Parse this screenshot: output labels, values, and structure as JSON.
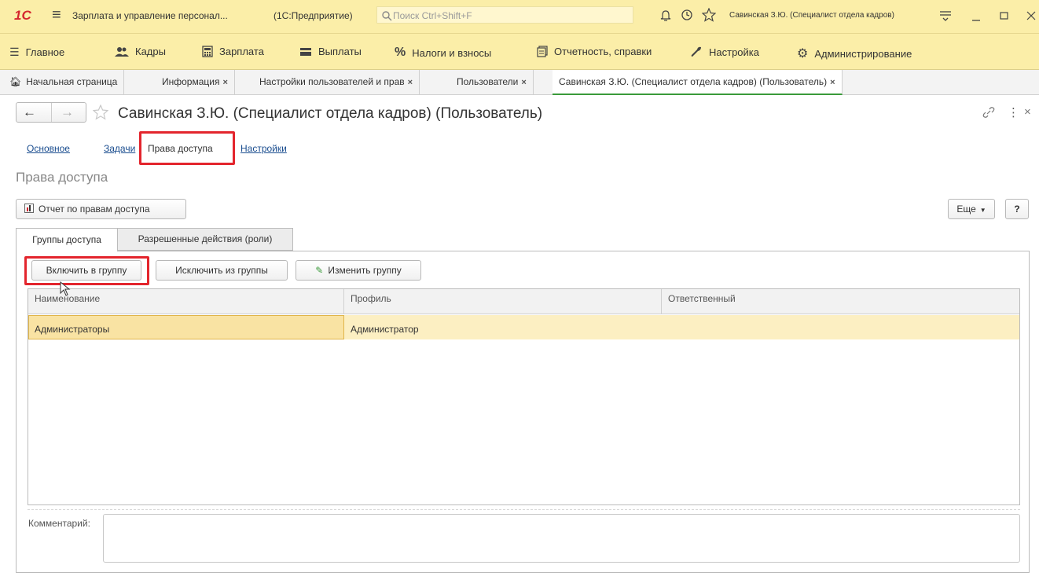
{
  "titlebar": {
    "logo": "1С",
    "menu_glyph": "≡",
    "app_title": "Зарплата и управление персонал...",
    "platform": "(1С:Предприятие)",
    "search_placeholder": "Поиск Ctrl+Shift+F",
    "user": "Савинская З.Ю. (Специалист отдела кадров)"
  },
  "menu": {
    "items": [
      {
        "label": "Главное",
        "icon": "menu-lines-icon"
      },
      {
        "label": "Кадры",
        "icon": "people-icon"
      },
      {
        "label": "Зарплата",
        "icon": "calculator-icon"
      },
      {
        "label": "Выплаты",
        "icon": "wallet-icon"
      },
      {
        "label": "Налоги и взносы",
        "icon": "percent-icon"
      },
      {
        "label": "Отчетность, справки",
        "icon": "documents-icon"
      },
      {
        "label": "Настройка",
        "icon": "wrench-icon"
      },
      {
        "label": "Администрирование",
        "icon": "gear-icon"
      }
    ]
  },
  "tabs": {
    "home": "Начальная страница",
    "items": [
      {
        "label": "Информация"
      },
      {
        "label": "Настройки пользователей и прав"
      },
      {
        "label": "Пользователи"
      },
      {
        "label": "Савинская З.Ю. (Специалист отдела кадров) (Пользователь)"
      }
    ]
  },
  "form": {
    "title": "Савинская З.Ю. (Специалист отдела кадров) (Пользователь)",
    "sections": [
      "Основное",
      "Задачи",
      "Права доступа",
      "Настройки"
    ],
    "active_section": "Права доступа",
    "heading": "Права доступа",
    "report_button": "Отчет по правам доступа",
    "more_button": "Еще",
    "help_button": "?"
  },
  "inner_tabs": [
    "Группы доступа",
    "Разрешенные действия (роли)"
  ],
  "toolbar": {
    "include": "Включить в группу",
    "exclude": "Исключить из группы",
    "edit": "Изменить группу"
  },
  "table": {
    "columns": [
      "Наименование",
      "Профиль",
      "Ответственный"
    ],
    "rows": [
      {
        "name": "Администраторы",
        "profile": "Администратор",
        "responsible": ""
      }
    ]
  },
  "comment_label": "Комментарий:",
  "colors": {
    "accent_yellow": "#fbeea8",
    "highlight_red": "#e3252d",
    "selected_row": "#fcefc2",
    "link_blue": "#1a4d8f"
  }
}
